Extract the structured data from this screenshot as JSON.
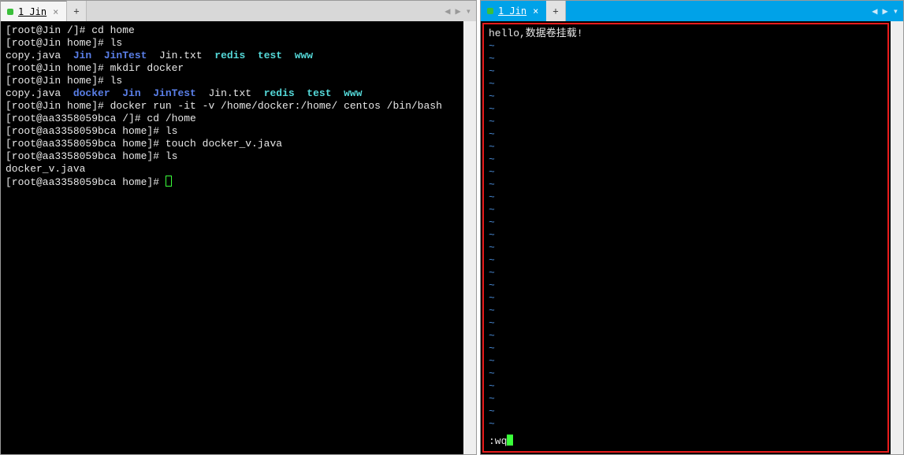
{
  "left": {
    "tab": {
      "label": "1 Jin",
      "close": "×"
    },
    "newtab": "+",
    "nav": {
      "prev": "◀",
      "next": "▶",
      "menu": "▾"
    },
    "lines": [
      {
        "segs": [
          {
            "t": "[root@Jin /]# cd home",
            "c": "w"
          }
        ]
      },
      {
        "segs": [
          {
            "t": "[root@Jin home]# ls",
            "c": "w"
          }
        ]
      },
      {
        "segs": [
          {
            "t": "copy.java  ",
            "c": "w"
          },
          {
            "t": "Jin  JinTest",
            "c": "b"
          },
          {
            "t": "  Jin.txt  ",
            "c": "w"
          },
          {
            "t": "redis  test  www",
            "c": "c"
          }
        ]
      },
      {
        "segs": [
          {
            "t": "[root@Jin home]# mkdir docker",
            "c": "w"
          }
        ]
      },
      {
        "segs": [
          {
            "t": "[root@Jin home]# ls",
            "c": "w"
          }
        ]
      },
      {
        "segs": [
          {
            "t": "copy.java  ",
            "c": "w"
          },
          {
            "t": "docker  Jin  JinTest",
            "c": "b"
          },
          {
            "t": "  Jin.txt  ",
            "c": "w"
          },
          {
            "t": "redis  test  www",
            "c": "c"
          }
        ]
      },
      {
        "segs": [
          {
            "t": "[root@Jin home]# docker run -it -v /home/docker:/home/ centos /bin/bash",
            "c": "w"
          }
        ]
      },
      {
        "segs": [
          {
            "t": "[root@aa3358059bca /]# cd /home",
            "c": "w"
          }
        ]
      },
      {
        "segs": [
          {
            "t": "[root@aa3358059bca home]# ls",
            "c": "w"
          }
        ]
      },
      {
        "segs": [
          {
            "t": "[root@aa3358059bca home]# touch docker_v.java",
            "c": "w"
          }
        ]
      },
      {
        "segs": [
          {
            "t": "[root@aa3358059bca home]# ls",
            "c": "w"
          }
        ]
      },
      {
        "segs": [
          {
            "t": "docker_v.java",
            "c": "w"
          }
        ]
      },
      {
        "segs": [
          {
            "t": "[root@aa3358059bca home]# ",
            "c": "w"
          }
        ],
        "cursor": "hollow"
      }
    ]
  },
  "right": {
    "tab": {
      "label": "1 Jin",
      "close": "×"
    },
    "newtab": "+",
    "nav": {
      "prev": "◀",
      "next": "▶",
      "menu": "▾"
    },
    "content_line": "hello,数据卷挂载!",
    "tilde_count": 31,
    "command_line": ":wq"
  }
}
